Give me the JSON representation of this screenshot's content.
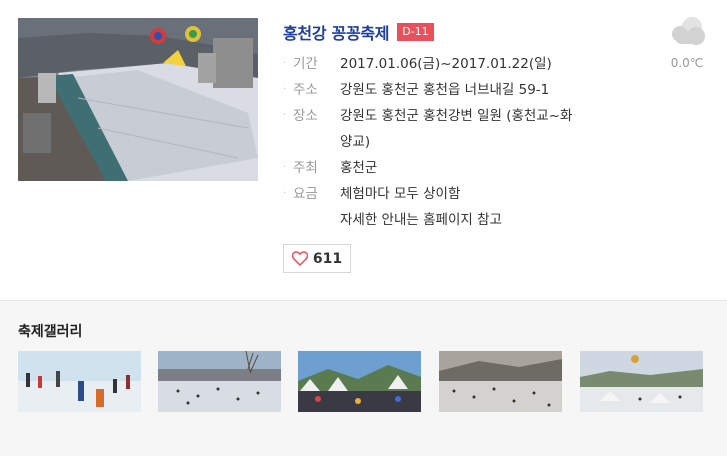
{
  "festival": {
    "title": "홍천강 꽁꽁축제",
    "dday": "D-11",
    "info": [
      {
        "label": "기간",
        "lines": [
          "2017.01.06(금)~2017.01.22(일)"
        ]
      },
      {
        "label": "주소",
        "lines": [
          "강원도 홍천군 홍천읍 너브내길 59-1"
        ]
      },
      {
        "label": "장소",
        "lines": [
          "강원도 홍천군 홍천강변 일원 (홍천교~화",
          "양교)"
        ]
      },
      {
        "label": "주최",
        "lines": [
          "홍천군"
        ]
      },
      {
        "label": "요금",
        "lines": [
          "체험마다 모두 상이함",
          "자세한 안내는 홈페이지 참고"
        ]
      }
    ],
    "likes": "611"
  },
  "weather": {
    "temp": "0.0℃",
    "icon": "cloud-icon"
  },
  "gallery": {
    "title": "축제갤러리",
    "thumbs": [
      "gallery-photo-1",
      "gallery-photo-2",
      "gallery-photo-3",
      "gallery-photo-4",
      "gallery-photo-5"
    ]
  },
  "colors": {
    "title": "#1f3fa0",
    "dday": "#e8505b",
    "heart": "#e8505b",
    "gallery_bg": "#f6f6f6"
  }
}
